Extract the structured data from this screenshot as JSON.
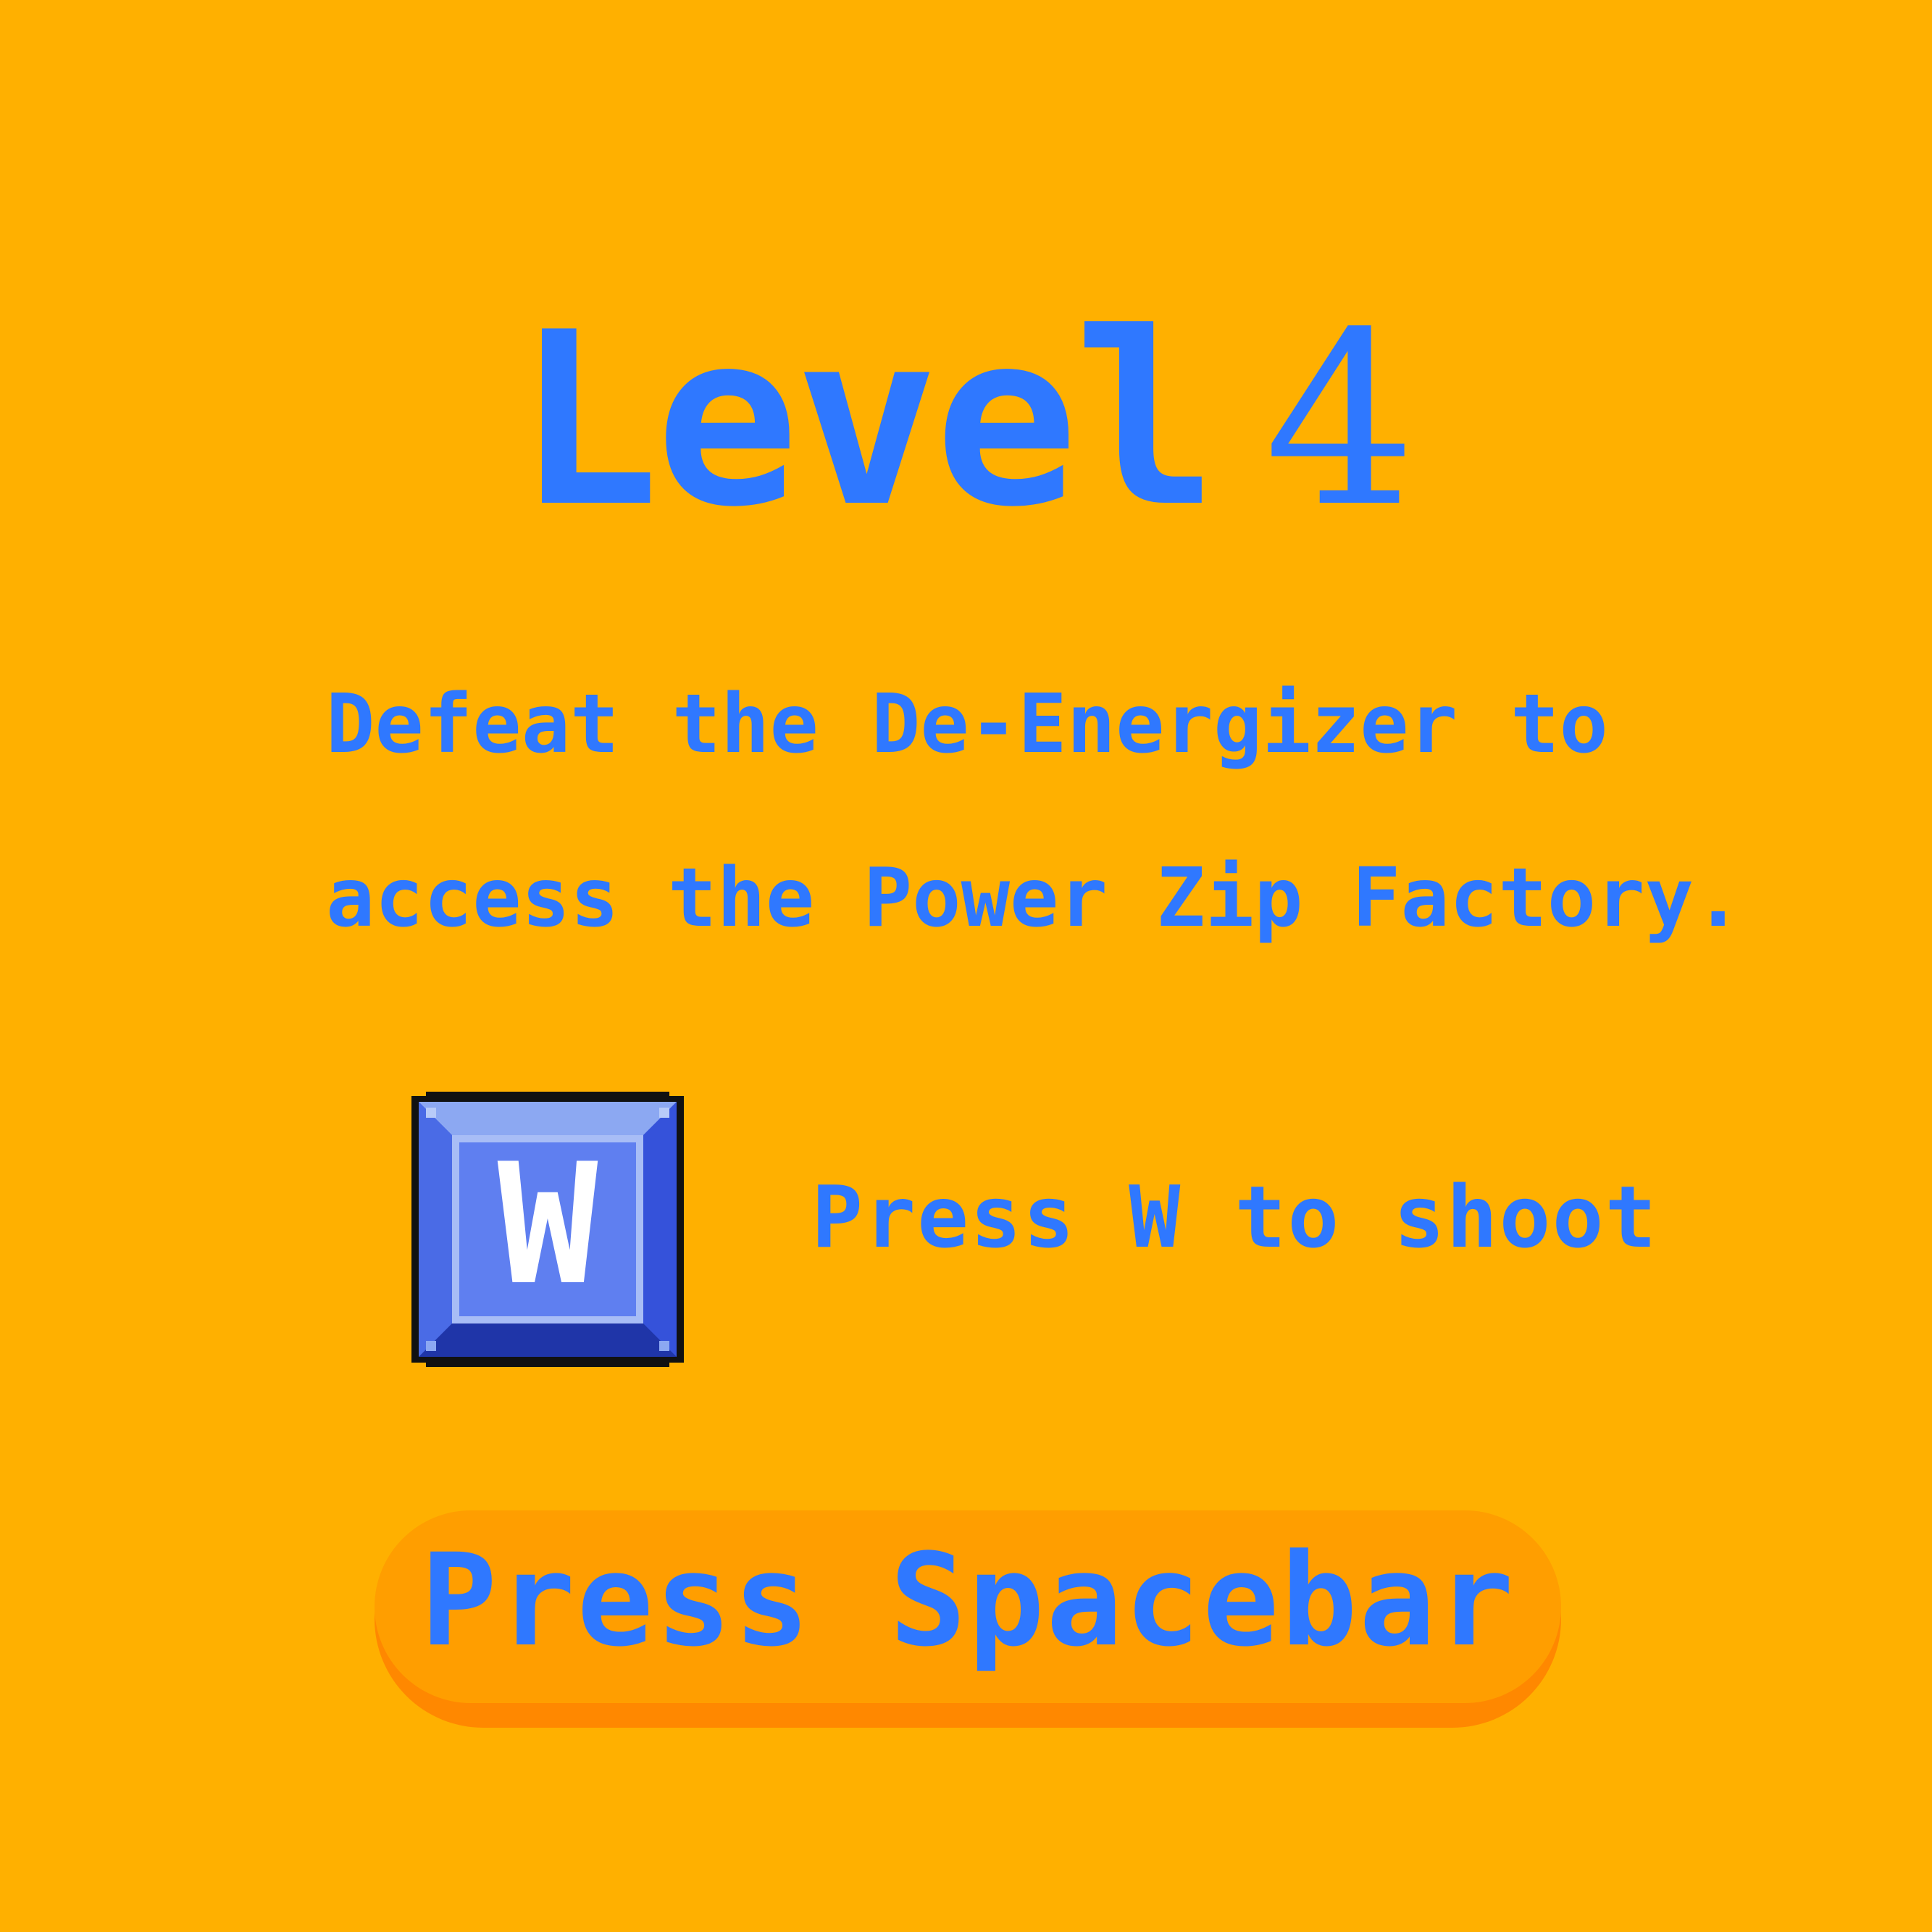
{
  "level": {
    "word": "Level",
    "number": "4"
  },
  "mission": {
    "line1_words": [
      "Defeat",
      "the",
      "De-Energizer",
      "to"
    ],
    "line2": "access the Power Zip Factory."
  },
  "controls": {
    "key_label": "W",
    "key_icon": "w-key-icon",
    "hint": "Press W to shoot"
  },
  "start_button": {
    "label": "Press Spacebar"
  },
  "colors": {
    "background": "#FFB000",
    "text": "#2F78FF",
    "button_face": "#FF9E00",
    "button_shadow": "#FF8800",
    "key_face": "#5F7FF0"
  }
}
